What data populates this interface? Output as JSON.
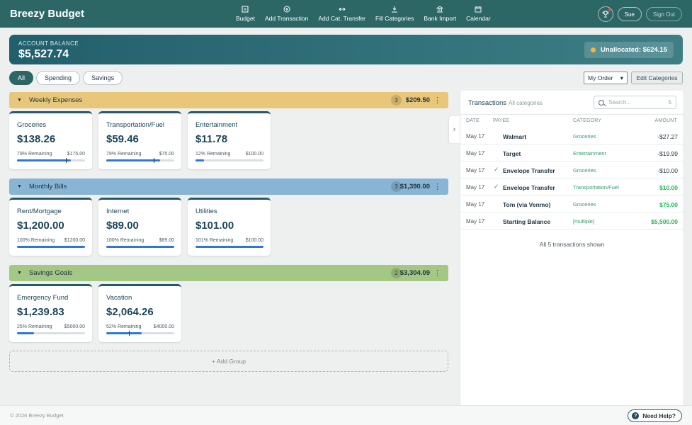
{
  "app": {
    "title": "Breezy Budget"
  },
  "nav": [
    {
      "label": "Budget",
      "icon": "budget-icon"
    },
    {
      "label": "Add Transaction",
      "icon": "plus-circle-icon"
    },
    {
      "label": "Add Cat. Transfer",
      "icon": "transfer-arrows-icon"
    },
    {
      "label": "Fill Categories",
      "icon": "download-icon"
    },
    {
      "label": "Bank Import",
      "icon": "bank-icon"
    },
    {
      "label": "Calendar",
      "icon": "calendar-icon"
    }
  ],
  "header": {
    "user": "Sue",
    "sign_out": "Sign Out",
    "trophy_icon": "trophy-icon"
  },
  "balance": {
    "label": "ACCOUNT BALANCE",
    "value": "$5,527.74",
    "unallocated": "Unallocated: $624.15"
  },
  "filters": {
    "all": "All",
    "spending": "Spending",
    "savings": "Savings"
  },
  "sort": {
    "selected": "My Order"
  },
  "edit_categories": "Edit Categories",
  "groups": [
    {
      "name": "Weekly Expenses",
      "count": "3",
      "total": "$209.50",
      "color": "#e8c77b",
      "categories": [
        {
          "name": "Groceries",
          "amount": "$138.26",
          "remaining": "79% Remaining",
          "budget": "$175.00",
          "fill": 0.79,
          "marker": 0.72
        },
        {
          "name": "Transportation/Fuel",
          "amount": "$59.46",
          "remaining": "79% Remaining",
          "budget": "$75.00",
          "fill": 0.79,
          "marker": 0.7
        },
        {
          "name": "Entertainment",
          "amount": "$11.78",
          "remaining": "12% Remaining",
          "budget": "$100.00",
          "fill": 0.12,
          "marker": null
        }
      ]
    },
    {
      "name": "Monthly Bills",
      "count": "3",
      "total": "$1,390.00",
      "color": "#88b5d4",
      "categories": [
        {
          "name": "Rent/Mortgage",
          "amount": "$1,200.00",
          "remaining": "100% Remaining",
          "budget": "$1200.00",
          "fill": 1.0,
          "marker": null
        },
        {
          "name": "Internet",
          "amount": "$89.00",
          "remaining": "100% Remaining",
          "budget": "$89.00",
          "fill": 1.0,
          "marker": null
        },
        {
          "name": "Utilities",
          "amount": "$101.00",
          "remaining": "101% Remaining",
          "budget": "$100.00",
          "fill": 1.0,
          "marker": null
        }
      ]
    },
    {
      "name": "Savings Goals",
      "count": "2",
      "total": "$3,304.09",
      "color": "#a3c785",
      "categories": [
        {
          "name": "Emergency Fund",
          "amount": "$1,239.83",
          "remaining": "25% Remaining",
          "budget": "$5000.00",
          "fill": 0.25,
          "marker": null
        },
        {
          "name": "Vacation",
          "amount": "$2,064.26",
          "remaining": "52% Remaining",
          "budget": "$4000.00",
          "fill": 0.52,
          "marker": 0.33
        }
      ]
    }
  ],
  "add_group": "+ Add Group",
  "transactions": {
    "title": "Transactions",
    "subtitle": "All categories",
    "search_placeholder": "Search...",
    "search_count": "5",
    "columns": [
      "DATE",
      "PAYEE",
      "CATEGORY",
      "AMOUNT"
    ],
    "rows": [
      {
        "date": "May 17",
        "check": false,
        "payee": "Walmart",
        "category": "Groceries",
        "amount": "-$27.27",
        "positive": false
      },
      {
        "date": "May 17",
        "check": false,
        "payee": "Target",
        "category": "Entertainment",
        "amount": "-$19.99",
        "positive": false
      },
      {
        "date": "May 17",
        "check": true,
        "payee": "Envelope Transfer",
        "category": "Groceries",
        "amount": "-$10.00",
        "positive": false
      },
      {
        "date": "May 17",
        "check": true,
        "payee": "Envelope Transfer",
        "category": "Transportation/Fuel",
        "amount": "$10.00",
        "positive": true
      },
      {
        "date": "May 17",
        "check": false,
        "payee": "Tom (via Venmo)",
        "category": "Groceries",
        "amount": "$75.00",
        "positive": true
      },
      {
        "date": "May 17",
        "check": false,
        "payee": "Starting Balance",
        "category": "[multiple]",
        "amount": "$5,500.00",
        "positive": true
      }
    ],
    "footer": "All 5 transactions shown"
  },
  "footer": {
    "copyright": "© 2026 Breezy Budget",
    "help": "Need Help?"
  }
}
